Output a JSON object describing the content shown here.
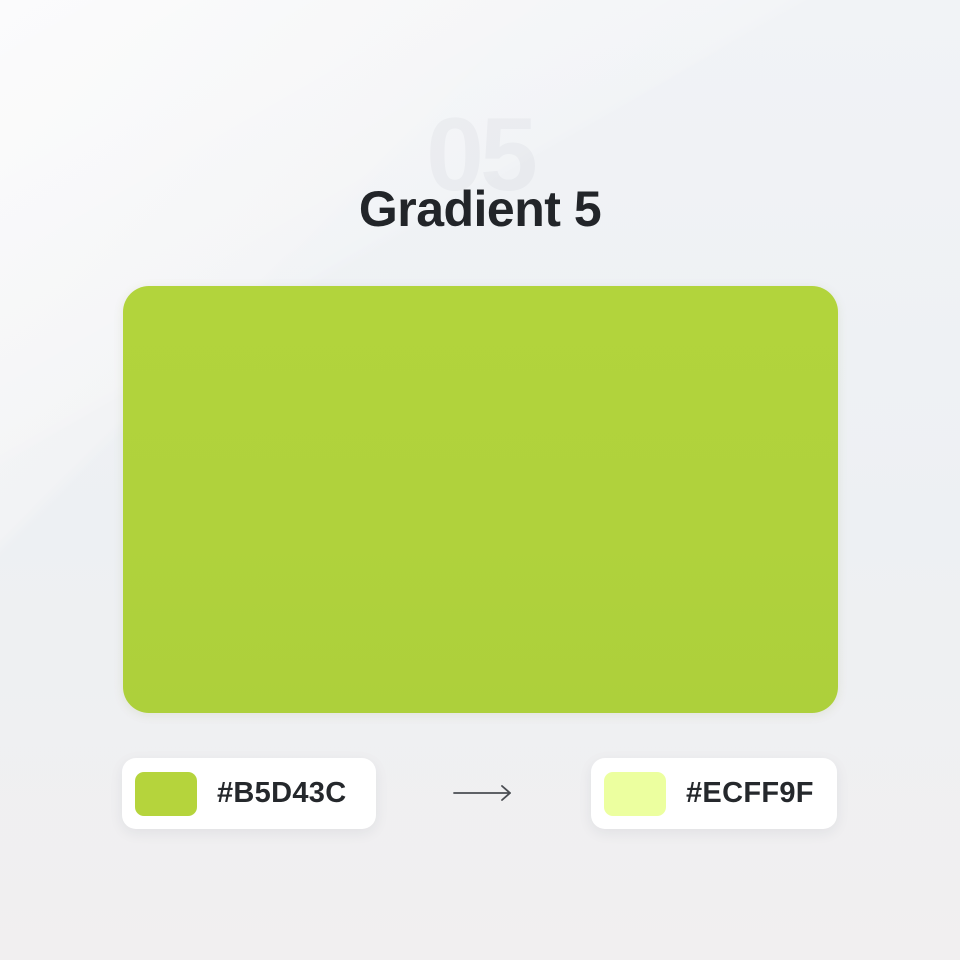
{
  "card": {
    "number": "05",
    "title": "Gradient 5",
    "start_color": "#B5D43C",
    "end_color": "#ECFF9F",
    "start_label": "#B5D43C",
    "end_label": "#ECFF9F",
    "arrow_icon": "arrow-right-icon"
  }
}
